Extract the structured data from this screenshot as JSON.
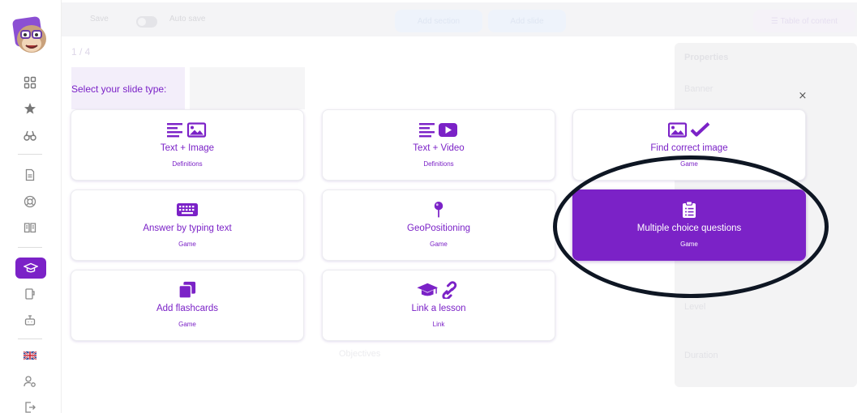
{
  "sidebar": {
    "icons": [
      "grid-icon",
      "star-icon",
      "binoculars-icon",
      "document-icon",
      "lifebuoy-icon",
      "book-icon",
      "graduation-cap-icon",
      "page-icon",
      "robot-icon",
      "uk-flag-icon",
      "user-settings-icon",
      "logout-icon"
    ],
    "active": "graduation-cap-icon"
  },
  "topbar": {
    "save_label": "Save",
    "autosave_label": "Auto save",
    "button1_label": "Add section",
    "button2_label": "Add slide",
    "toc_label": "☰ Table of content"
  },
  "breadcrumb": "1 / 4",
  "properties": {
    "title": "Properties",
    "banner_label": "Banner",
    "level_label": "Level",
    "duration_label": "Duration"
  },
  "objectives_label": "Objectives",
  "modal": {
    "title": "Select your slide type:",
    "close_symbol": "×",
    "cards": [
      {
        "label": "Text + Image",
        "sub": "Definitions",
        "icon": "text-image-icon",
        "selected": false
      },
      {
        "label": "Text + Video",
        "sub": "Definitions",
        "icon": "text-video-icon",
        "selected": false
      },
      {
        "label": "Find correct image",
        "sub": "Game",
        "icon": "image-check-icon",
        "selected": false
      },
      {
        "label": "Answer by typing text",
        "sub": "Game",
        "icon": "keyboard-icon",
        "selected": false
      },
      {
        "label": "GeoPositioning",
        "sub": "Game",
        "icon": "map-pin-icon",
        "selected": false
      },
      {
        "label": "Multiple choice questions",
        "sub": "Game",
        "icon": "clipboard-list-icon",
        "selected": true
      },
      {
        "label": "Add flashcards",
        "sub": "Game",
        "icon": "flashcards-icon",
        "selected": false
      },
      {
        "label": "Link a lesson",
        "sub": "Link",
        "icon": "cap-link-icon",
        "selected": false
      }
    ]
  },
  "colors": {
    "accent": "#7b22c7",
    "annotation": "#0e1623"
  }
}
